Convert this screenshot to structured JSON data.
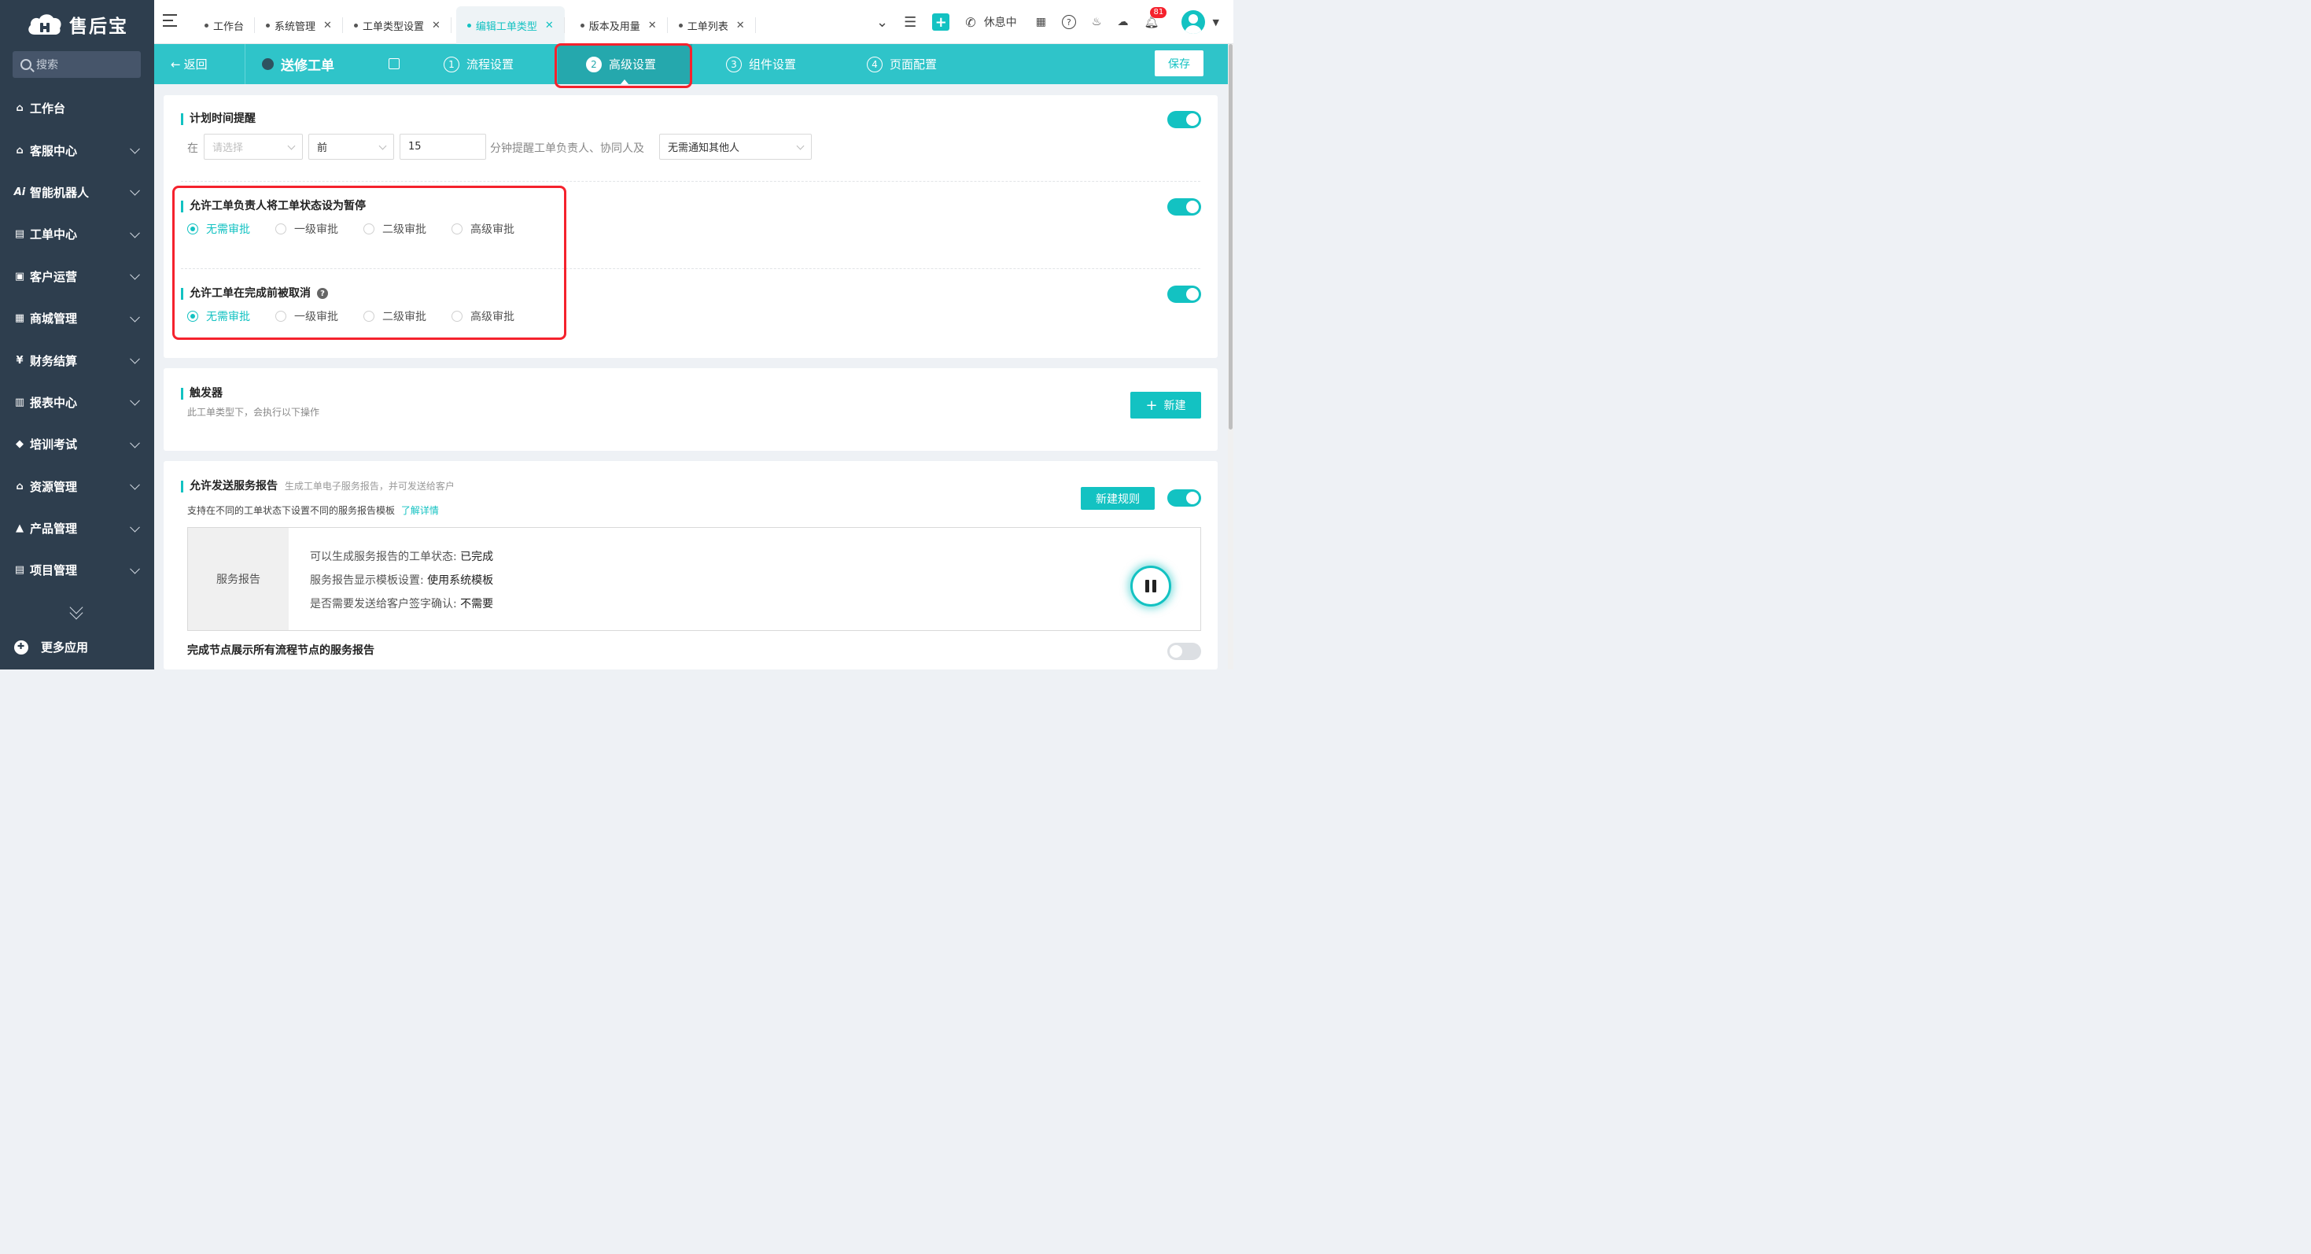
{
  "app": {
    "name": "售后宝"
  },
  "sidebar": {
    "search_placeholder": "搜索",
    "items": [
      {
        "label": "工作台",
        "icon": "home-icon"
      },
      {
        "label": "客服中心",
        "icon": "headset-icon"
      },
      {
        "label": "智能机器人",
        "icon": "ai-icon"
      },
      {
        "label": "工单中心",
        "icon": "ticket-icon"
      },
      {
        "label": "客户运营",
        "icon": "customer-icon"
      },
      {
        "label": "商城管理",
        "icon": "store-icon"
      },
      {
        "label": "财务结算",
        "icon": "yen-icon"
      },
      {
        "label": "报表中心",
        "icon": "chart-icon"
      },
      {
        "label": "培训考试",
        "icon": "graduation-icon"
      },
      {
        "label": "资源管理",
        "icon": "resource-icon"
      },
      {
        "label": "产品管理",
        "icon": "product-icon"
      },
      {
        "label": "项目管理",
        "icon": "project-icon"
      }
    ],
    "more_apps": "更多应用"
  },
  "topbar": {
    "tabs": [
      {
        "label": "工作台",
        "closable": false
      },
      {
        "label": "系统管理",
        "closable": true
      },
      {
        "label": "工单类型设置",
        "closable": true
      },
      {
        "label": "编辑工单类型",
        "closable": true,
        "active": true
      },
      {
        "label": "版本及用量",
        "closable": true
      },
      {
        "label": "工单列表",
        "closable": true
      }
    ],
    "status": "休息中",
    "notification_count": "81"
  },
  "stepbar": {
    "back": "返回",
    "type_name": "送修工单",
    "steps": [
      {
        "num": "1",
        "label": "流程设置"
      },
      {
        "num": "2",
        "label": "高级设置",
        "active": true
      },
      {
        "num": "3",
        "label": "组件设置"
      },
      {
        "num": "4",
        "label": "页面配置"
      }
    ],
    "save": "保存"
  },
  "reminder": {
    "title": "计划时间提醒",
    "prefix": "在",
    "select1_placeholder": "请选择",
    "select2_value": "前",
    "minutes_value": "15",
    "middle_text": "分钟提醒工单负责人、协同人及",
    "select3_value": "无需通知其他人"
  },
  "approval_options": [
    "无需审批",
    "一级审批",
    "二级审批",
    "高级审批"
  ],
  "pause": {
    "title": "允许工单负责人将工单状态设为暂停",
    "selected": "无需审批"
  },
  "cancel": {
    "title": "允许工单在完成前被取消",
    "selected": "无需审批"
  },
  "trigger": {
    "title": "触发器",
    "subtitle": "此工单类型下，会执行以下操作",
    "new_button": "新建"
  },
  "report": {
    "title": "允许发送服务报告",
    "title_hint": "生成工单电子服务报告，并可发送给客户",
    "desc": "支持在不同的工单状态下设置不同的服务报告模板",
    "link": "了解详情",
    "new_rule": "新建规则",
    "box_label": "服务报告",
    "lines": [
      {
        "key": "可以生成服务报告的工单状态: ",
        "value": "已完成"
      },
      {
        "key": "服务报告显示模板设置: ",
        "value": "使用系统模板"
      },
      {
        "key": "是否需要发送给客户签字确认: ",
        "value": "不需要"
      }
    ],
    "node_display": "完成节点展示所有流程节点的服务报告"
  },
  "colors": {
    "accent": "#13c2c2",
    "sidebar": "#2e3e4e",
    "highlight": "#f5222d"
  }
}
